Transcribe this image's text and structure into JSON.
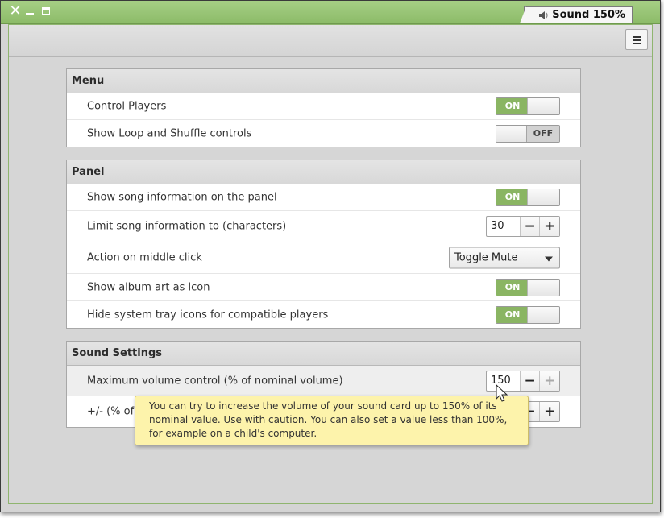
{
  "window": {
    "title": "Sound 150%",
    "accent_color": "#8ab563",
    "controls": [
      "close-icon",
      "minimize-icon",
      "maximize-icon"
    ]
  },
  "toolbar": {
    "menu_icon": "hamburger-icon"
  },
  "sections": {
    "menu": {
      "title": "Menu",
      "control_players": {
        "label": "Control Players",
        "state": "ON"
      },
      "loop_shuffle": {
        "label": "Show Loop and Shuffle controls",
        "state": "OFF"
      }
    },
    "panel": {
      "title": "Panel",
      "song_info": {
        "label": "Show song information on the panel",
        "state": "ON"
      },
      "limit_chars": {
        "label": "Limit song information to (characters)",
        "value": "30",
        "minus": "−",
        "plus": "+"
      },
      "middle_click": {
        "label": "Action on middle click",
        "selected": "Toggle Mute"
      },
      "album_art": {
        "label": "Show album art as icon",
        "state": "ON"
      },
      "hide_tray": {
        "label": "Hide system tray icons for compatible players",
        "state": "ON"
      }
    },
    "sound": {
      "title": "Sound Settings",
      "max_volume": {
        "label": "Maximum volume control (% of nominal volume)",
        "value": "150",
        "minus": "−",
        "plus": "+"
      },
      "step": {
        "label": "+/- (% of",
        "minus": "−",
        "plus": "+"
      }
    }
  },
  "tooltip": {
    "text": "You can try to increase the volume of your sound card up to 150% of its nominal value. Use with caution. You can also set a value less than 100%, for example on a child's computer."
  }
}
